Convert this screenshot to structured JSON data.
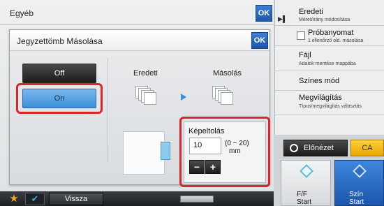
{
  "background_window": {
    "title": "Egyéb",
    "ok_label": "OK"
  },
  "dialog": {
    "title": "Jegyzettömb Másolása",
    "ok_label": "OK",
    "off_label": "Off",
    "on_label": "On",
    "col_original": "Eredeti",
    "col_copy": "Másolás",
    "shift": {
      "label": "Képeltolás",
      "value": "10",
      "range_line1": "(0 ~ 20)",
      "range_line2": "mm",
      "minus_label": "−",
      "plus_label": "+"
    }
  },
  "right_panel": {
    "items": [
      {
        "title": "Eredeti",
        "sub": "Méret/irány módosítása"
      },
      {
        "title": "Próbanyomat",
        "sub": "1 ellenőrző old. másolása"
      },
      {
        "title": "Fájl",
        "sub": "Adatok mentése mappába"
      },
      {
        "title": "Színes mód",
        "sub": ""
      },
      {
        "title": "Megvilágítás",
        "sub": "Típus/megvilágítás választás"
      }
    ],
    "preview_label": "Előnézet",
    "ca_label": "CA",
    "start_bw_line1": "F/F",
    "start_bw_line2": "Start",
    "start_color_line1": "Szín",
    "start_color_line2": "Start"
  },
  "bottom_bar": {
    "back_label": "Vissza"
  },
  "colors": {
    "accent": "#1f56a8",
    "highlight": "#d9262a",
    "selected": "#5aa6e6"
  }
}
